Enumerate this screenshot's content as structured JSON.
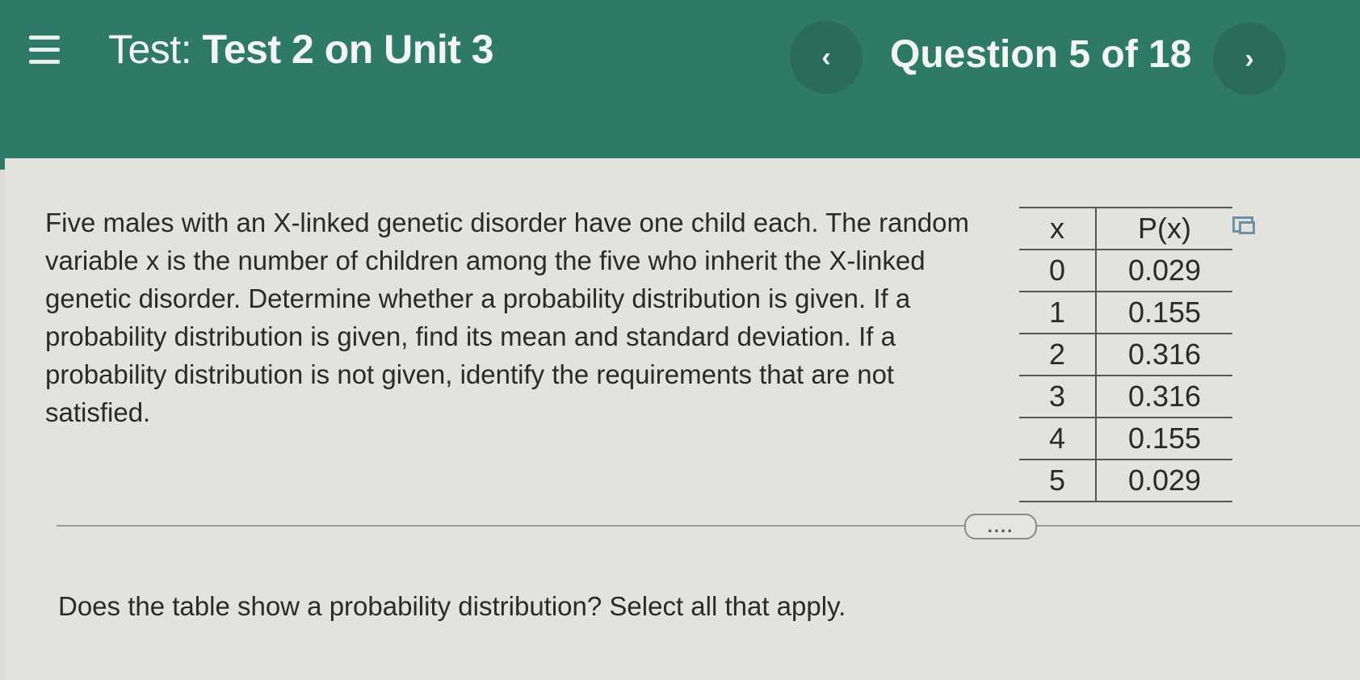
{
  "header": {
    "title_prefix": "Test:",
    "title_name": "Test 2 on Unit 3",
    "question_counter": "Question 5 of 18",
    "prev_icon": "‹",
    "next_icon": "›"
  },
  "problem": {
    "text": "Five males with an X-linked genetic disorder have one child each. The random variable x is the number of children among the five who inherit the X-linked genetic disorder. Determine whether a probability distribution is given. If a probability distribution is given, find its mean and standard deviation. If a probability distribution is not given, identify the requirements that are not satisfied."
  },
  "table": {
    "headers": [
      "x",
      "P(x)"
    ],
    "rows": [
      [
        "0",
        "0.029"
      ],
      [
        "1",
        "0.155"
      ],
      [
        "2",
        "0.316"
      ],
      [
        "3",
        "0.316"
      ],
      [
        "4",
        "0.155"
      ],
      [
        "5",
        "0.029"
      ]
    ]
  },
  "expand_label": "....",
  "question": {
    "prompt": "Does the table show a probability distribution? Select all that apply."
  },
  "icons": {
    "menu": "hamburger-menu-icon",
    "copy": "copy-table-icon",
    "prev": "chevron-left-icon",
    "next": "chevron-right-icon"
  }
}
